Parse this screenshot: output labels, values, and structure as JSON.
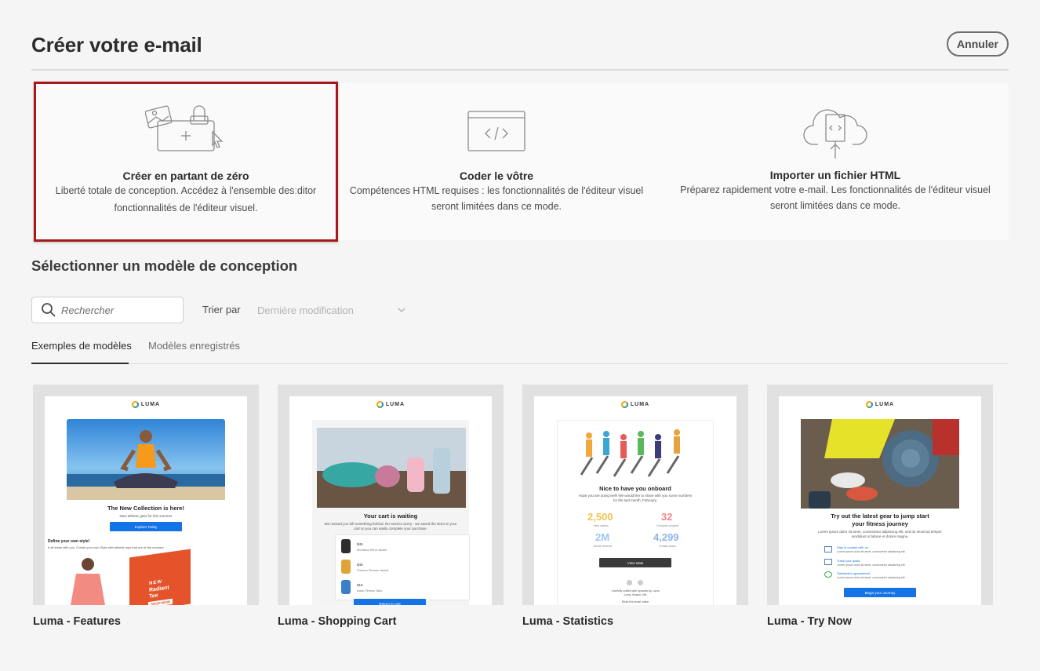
{
  "dialog": {
    "title": "Créer votre e-mail",
    "cancel_label": "Annuler"
  },
  "options": [
    {
      "title": "Créer en partant de zéro",
      "desc_line1": "Liberté totale de conception. Accédez à l'ensemble desːditor",
      "desc_line2": "fonctionnalités de l'éditeur visuel.",
      "icon": "design-canvas-icon",
      "selected": true
    },
    {
      "title": "Coder le vôtre",
      "desc_line1": "Compétences HTML requises : les fonctionnalités de l'éditeur visuel",
      "desc_line2": "seront limitées dans ce mode.",
      "icon": "code-window-icon"
    },
    {
      "title": "Importer un fichier HTML",
      "desc_line1": "Préparez rapidement votre e-mail. Les fonctionnalités de l'éditeur  visuel",
      "desc_line2": "seront limitées dans ce mode.",
      "icon": "cloud-upload-icon"
    }
  ],
  "templates_section": {
    "title": "Sélectionner un modèle de conception",
    "search_placeholder": "Rechercher",
    "sort_label": "Trier par",
    "sort_value": "Dernière modification"
  },
  "tabs": [
    {
      "label": "Exemples de modèles",
      "active": true
    },
    {
      "label": "Modèles enregistrés",
      "active": false
    }
  ],
  "templates": [
    {
      "name": "Luma - Features",
      "brand": "LUMA",
      "headline": "The New Collection is here!",
      "subline": "New athletic gear for this summer",
      "button": "Explore Today",
      "section_head": "Define your own style!",
      "section_text": "It all starts with you. Create your own Style with athletic tops that are of the moment",
      "promo_line1": "NEW",
      "promo_line2": "Radiant",
      "promo_line3": "Tee",
      "promo_button": "SHOP NOW"
    },
    {
      "name": "Luma - Shopping Cart",
      "brand": "LUMA",
      "headline": "Your cart is waiting",
      "subline": "We noticed you left something behind. No need to worry - we saved the items in your cart so you can easily complete your purchase.",
      "items": [
        {
          "price": "$45",
          "label": "Montana Wind Jacket"
        },
        {
          "price": "$45",
          "label": "Proteus Fitness Jacket"
        },
        {
          "price": "$18",
          "label": "Atlas Fitness Tank"
        }
      ],
      "button": "Return to cart"
    },
    {
      "name": "Luma - Statistics",
      "brand": "LUMA",
      "headline": "Nice to have you onboard",
      "subline": "Hope you are doing well! We would like to share with you some numbers for the last month, February.",
      "stats": [
        {
          "value": "2,500",
          "label": "New visitors",
          "color": "#f5c24d"
        },
        {
          "value": "32",
          "label": "Complete projects",
          "color": "#f08a8a"
        },
        {
          "value": "2M",
          "label": "Month revenue",
          "color": "#9ec4f5"
        },
        {
          "value": "4,299",
          "label": "Created tasks",
          "color": "#8fb4e8"
        }
      ],
      "button": "View stats",
      "footer_line1": "Carefully crafted with dynamic by Luma",
      "footer_line2": "Luma, Boston, MA",
      "footer_line3": "Read this email online"
    },
    {
      "name": "Luma - Try Now",
      "brand": "LUMA",
      "headline_line1": "Try out the latest gear to jump start",
      "headline_line2": "your fitness journey",
      "subline": "Lorem ipsum dolor sit amet, consectetur adipiscing elit, sed do eiusmod tempor incididunt ut labore et dolore magna.",
      "features": [
        {
          "title": "Stay in contact with us",
          "text": "Lorem ipsum dolor sit amet, consectetur adipiscing elit."
        },
        {
          "title": "Track your goals",
          "text": "Lorem ipsum dolor sit amet, consectetur adipiscing elit."
        },
        {
          "title": "Satisfaction guaranteed",
          "text": "Lorem ipsum dolor sit amet, consectetur adipiscing elit."
        }
      ],
      "button": "Begin your Journey"
    }
  ],
  "colors": {
    "selected_border": "#a7191a",
    "accent_blue": "#1473e6",
    "background": "#f5f5f5"
  }
}
